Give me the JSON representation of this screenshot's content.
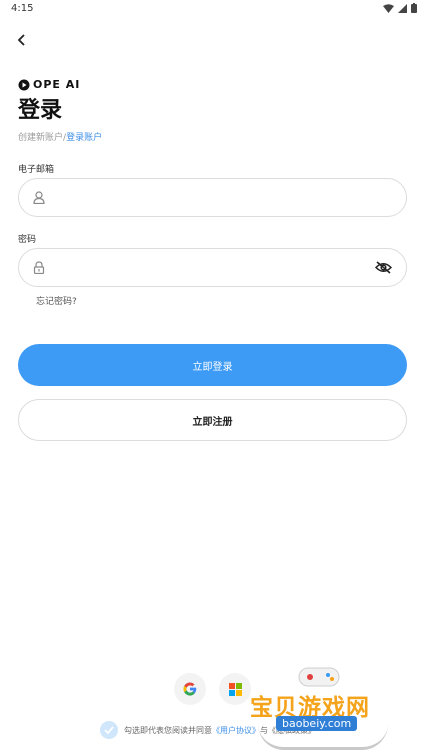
{
  "status": {
    "time": "4:15"
  },
  "brand": {
    "logo_text": "OPE AI"
  },
  "page": {
    "title": "登录"
  },
  "crumbs": {
    "first": "创建新账户",
    "separator": "/",
    "second": "登录账户"
  },
  "email": {
    "label": "电子邮箱",
    "placeholder": ""
  },
  "password": {
    "label": "密码",
    "placeholder": ""
  },
  "forgot": "忘记密码?",
  "buttons": {
    "login": "立即登录",
    "register": "立即注册"
  },
  "agreement": {
    "prefix": "勾选即代表您阅读并同意",
    "link": "《用户协议》",
    "suffix": "与《隐私政策》"
  },
  "watermark": {
    "title": "宝贝游戏网",
    "site": "baobeiy.com"
  },
  "colors": {
    "accent": "#3d9bf5",
    "link": "#3e8fe8"
  },
  "icons": [
    "back-arrow-icon",
    "user-icon",
    "lock-icon",
    "eye-off-icon",
    "google-icon",
    "microsoft-icon",
    "check-icon"
  ]
}
